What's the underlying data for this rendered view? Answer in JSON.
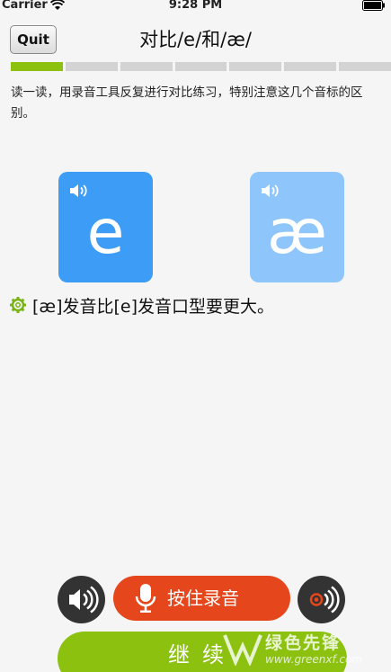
{
  "status_bar": {
    "carrier": "Carrier",
    "time": "9:28 PM"
  },
  "nav": {
    "quit_label": "Quit",
    "title": "对比/e/和/æ/"
  },
  "progress": {
    "completed": 1,
    "total": 7
  },
  "instruction": "读一读，用录音工具反复进行对比练习，特别注意这几个音标的区别。",
  "cards": [
    {
      "symbol": "e",
      "color": "#3d9cf5"
    },
    {
      "symbol": "æ",
      "color": "#8ec6fb"
    }
  ],
  "tip": "[æ]发音比[e]发音口型要更大。",
  "controls": {
    "record_label": "按住录音",
    "continue_label": "继续"
  },
  "watermark": {
    "text": "绿色先锋",
    "url": "www.greenxf.com"
  },
  "colors": {
    "accent_green": "#8cc110",
    "record_red": "#e5461b",
    "card_blue": "#3d9cf5",
    "card_light_blue": "#8ec6fb"
  }
}
